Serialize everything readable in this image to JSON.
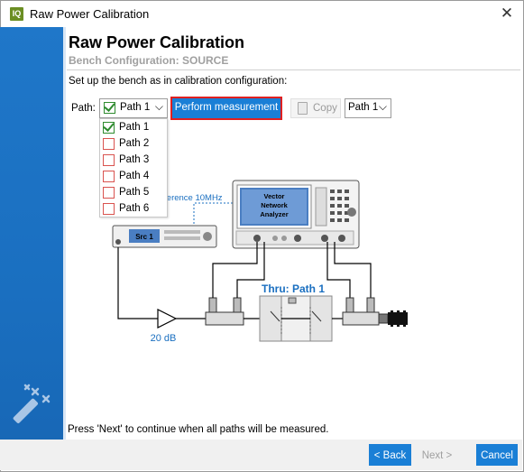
{
  "window": {
    "title": "Raw Power Calibration",
    "app_icon_text": "IQ"
  },
  "header": {
    "title": "Raw Power Calibration",
    "subtitle": "Bench Configuration: SOURCE"
  },
  "instructions": "Set up the bench as in calibration configuration:",
  "path_selector": {
    "label": "Path:",
    "selected": "Path 1",
    "items": [
      {
        "label": "Path 1",
        "checked": true
      },
      {
        "label": "Path 2",
        "checked": false
      },
      {
        "label": "Path 3",
        "checked": false
      },
      {
        "label": "Path 4",
        "checked": false
      },
      {
        "label": "Path 5",
        "checked": false
      },
      {
        "label": "Path 6",
        "checked": false
      }
    ]
  },
  "actions": {
    "perform_label": "Perform measurement",
    "copy_label": "Copy",
    "copy_target": "Path 1"
  },
  "diagram": {
    "reference_label": "Reference 10MHz",
    "vna_label_line1": "Vector",
    "vna_label_line2": "Network",
    "vna_label_line3": "Analyzer",
    "source_label": "Src 1",
    "amp_label": "20 dB",
    "thru_label": "Thru: Path 1"
  },
  "footer_note": "Press 'Next' to continue when all paths will be measured.",
  "buttons": {
    "back": "< Back",
    "next": "Next >",
    "cancel": "Cancel"
  },
  "colors": {
    "accent": "#1a7fd6",
    "highlight_border": "#e02020",
    "checked": "#2e8b2e",
    "unchecked": "#d9534f"
  }
}
